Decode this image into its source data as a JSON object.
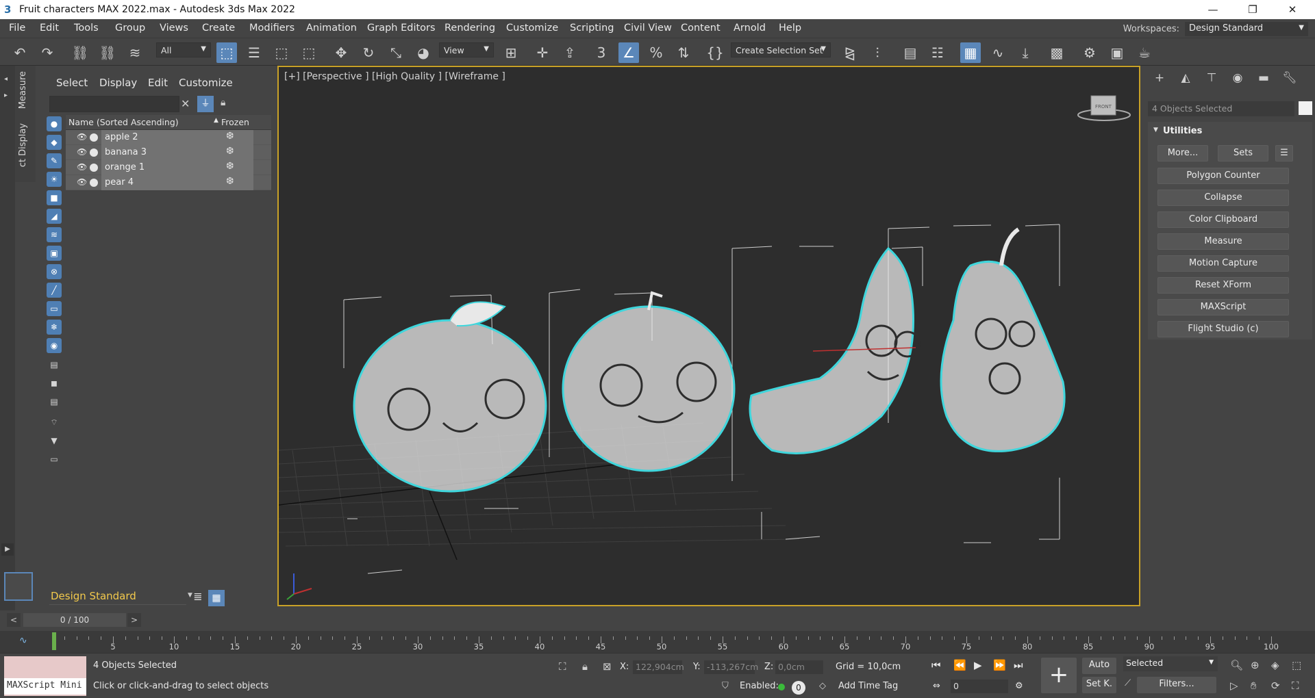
{
  "window": {
    "title": "Fruit characters MAX 2022.max - Autodesk 3ds Max 2022",
    "app_icon": "3",
    "minimize": "—",
    "maximize": "❐",
    "close": "✕"
  },
  "menubar": {
    "items": [
      "File",
      "Edit",
      "Tools",
      "Group",
      "Views",
      "Create",
      "Modifiers",
      "Animation",
      "Graph Editors",
      "Rendering",
      "Customize",
      "Scripting",
      "Civil View",
      "Content",
      "Arnold",
      "Help"
    ],
    "workspaces_label": "Workspaces:",
    "workspace_value": "Design Standard"
  },
  "toolbar": {
    "filter_value": "All",
    "refcoord_value": "View",
    "selection_set_placeholder": "Create Selection Set"
  },
  "side_tabs": [
    "Measure",
    "ct Display"
  ],
  "scene_explorer": {
    "menu": [
      "Select",
      "Display",
      "Edit",
      "Customize"
    ],
    "search_value": "",
    "column_name": "Name (Sorted Ascending)",
    "column_frozen": "Frozen",
    "rows": [
      {
        "name": "apple 2"
      },
      {
        "name": "banana 3"
      },
      {
        "name": "orange 1"
      },
      {
        "name": "pear 4"
      }
    ],
    "workspace_bottom": "Design Standard"
  },
  "viewport": {
    "label": "[+] [Perspective ] [High Quality ] [Wireframe ]",
    "viewcube_label": "FRONT"
  },
  "command_panel": {
    "selection_field": "4 Objects Selected",
    "rollout_title": "Utilities",
    "more_button": "More...",
    "sets_button": "Sets",
    "utilities": [
      "Polygon Counter",
      "Collapse",
      "Color Clipboard",
      "Measure",
      "Motion Capture",
      "Reset XForm",
      "MAXScript",
      "Flight Studio (c)"
    ]
  },
  "timeline": {
    "frame_display": "0 / 100",
    "prev": "<",
    "next": ">",
    "ticks": [
      "5",
      "10",
      "15",
      "20",
      "25",
      "30",
      "35",
      "40",
      "45",
      "50",
      "55",
      "60",
      "65",
      "70",
      "75",
      "80",
      "85",
      "90",
      "95",
      "100"
    ]
  },
  "status": {
    "maxscript_placeholder": "MAXScript Mini",
    "selection_info": "4 Objects Selected",
    "prompt": "Click or click-and-drag to select objects",
    "x_label": "X:",
    "x_value": "122,904cm",
    "y_label": "Y:",
    "y_value": "-113,267cm",
    "z_label": "Z:",
    "z_value": "0,0cm",
    "grid": "Grid = 10,0cm",
    "enabled_label": "Enabled:",
    "enabled_value": "0",
    "add_time_tag": "Add Time Tag",
    "auto_key": "Auto",
    "set_key": "Set K.",
    "key_filter_value": "Selected",
    "filters_button": "Filters...",
    "current_frame": "0"
  },
  "colors": {
    "accent": "#5b87b9",
    "viewport_border": "#c9a227",
    "selection_outline": "#3fd6dc",
    "workspace_text": "#f2c94c"
  }
}
